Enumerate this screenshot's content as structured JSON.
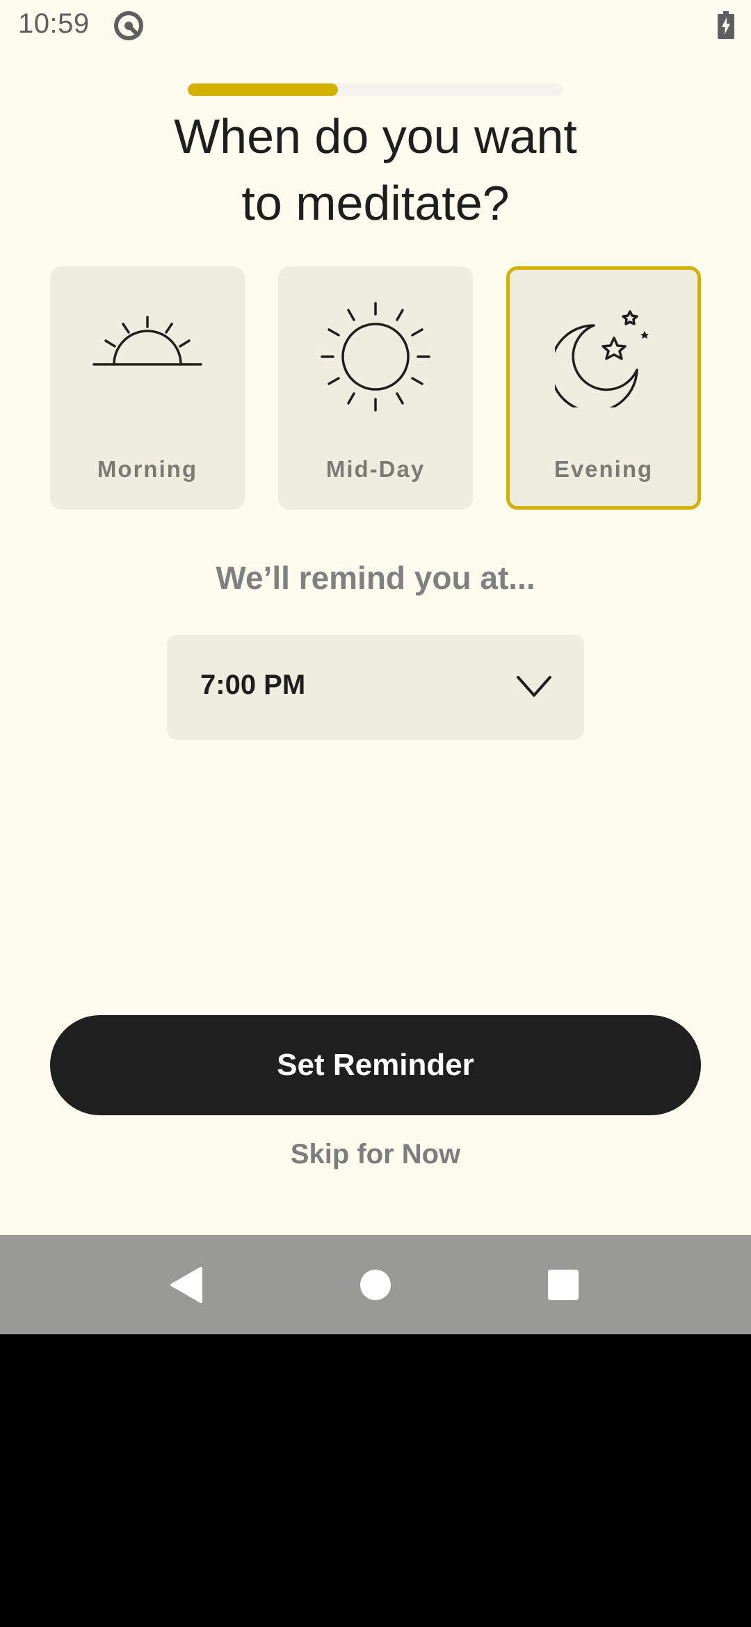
{
  "status_bar": {
    "time": "10:59"
  },
  "onboarding": {
    "progress_fraction": 0.4
  },
  "title": {
    "line1": "When do you want",
    "line2": "to meditate?"
  },
  "options": [
    {
      "label": "Morning",
      "icon": "sunrise-icon",
      "selected": false
    },
    {
      "label": "Mid-Day",
      "icon": "sun-icon",
      "selected": false
    },
    {
      "label": "Evening",
      "icon": "moon-stars-icon",
      "selected": true
    }
  ],
  "reminder": {
    "label": "We’ll remind you at...",
    "time": "7:00 PM"
  },
  "actions": {
    "primary_label": "Set Reminder",
    "skip_label": "Skip for Now"
  },
  "colors": {
    "accent": "#d4b000",
    "background": "#fdfcef",
    "card": "#efede0",
    "button": "#1f1f1f"
  }
}
